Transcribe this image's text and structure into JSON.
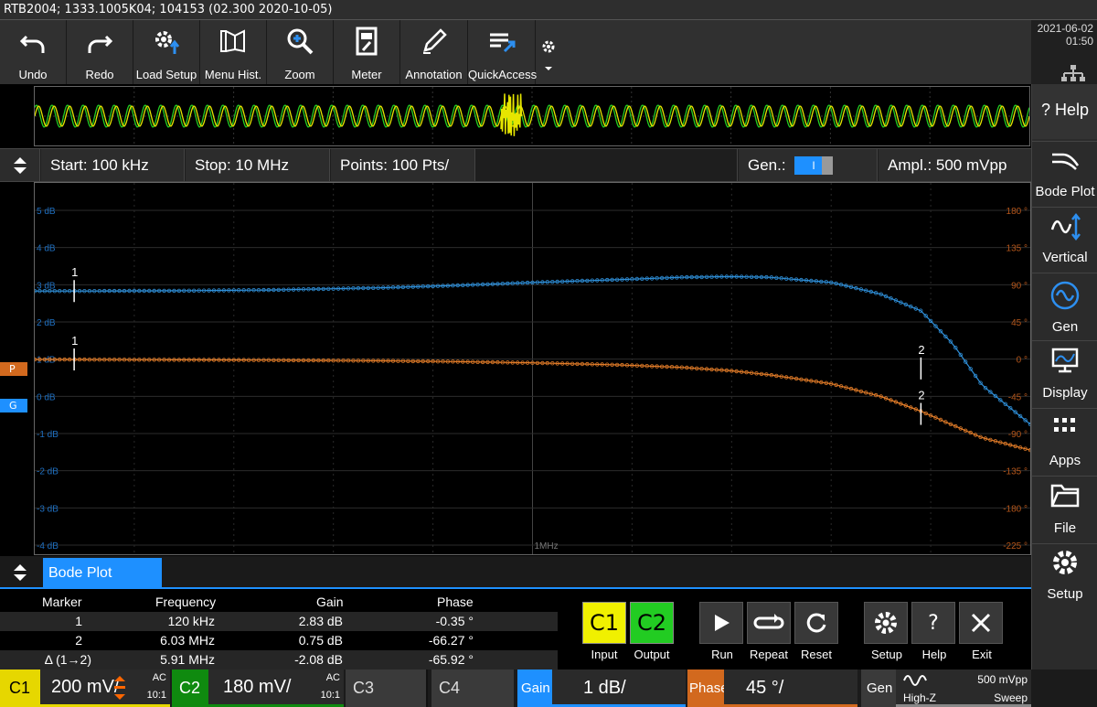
{
  "window": {
    "title": "RTB2004; 1333.1005K04; 104153 (02.300 2020-10-05)"
  },
  "datetime": {
    "date": "2021-06-02",
    "time": "01:50"
  },
  "toolbar": {
    "items": [
      {
        "label": "Undo",
        "icon": "undo-icon"
      },
      {
        "label": "Redo",
        "icon": "redo-icon"
      },
      {
        "label": "Load Setup",
        "icon": "load-setup-icon"
      },
      {
        "label": "Menu Hist.",
        "icon": "menu-history-icon"
      },
      {
        "label": "Zoom",
        "icon": "zoom-icon"
      },
      {
        "label": "Meter",
        "icon": "meter-icon"
      },
      {
        "label": "Annotation",
        "icon": "annotation-icon"
      },
      {
        "label": "QuickAccess",
        "icon": "quick-access-icon"
      }
    ]
  },
  "sidebar": {
    "items": [
      {
        "label": "Help",
        "icon": "help-icon"
      },
      {
        "label": "Bode Plot",
        "icon": "bode-plot-icon"
      },
      {
        "label": "Vertical",
        "icon": "vertical-icon"
      },
      {
        "label": "Gen",
        "icon": "generator-icon"
      },
      {
        "label": "Display",
        "icon": "display-icon"
      },
      {
        "label": "Apps",
        "icon": "apps-icon"
      },
      {
        "label": "File",
        "icon": "file-icon"
      },
      {
        "label": "Setup",
        "icon": "setup-icon"
      }
    ]
  },
  "params": {
    "start": "Start: 100 kHz",
    "stop": "Stop: 10 MHz",
    "points": "Points: 100 Pts/",
    "gen_label": "Gen.:",
    "gen_state": "I",
    "ampl": "Ampl.: 500 mVpp"
  },
  "plot": {
    "gain_labels": [
      "5 dB",
      "4 dB",
      "3 dB",
      "2 dB",
      "1 dB",
      "0 dB",
      "-1 dB",
      "-2 dB",
      "-3 dB",
      "-4 dB"
    ],
    "phase_labels": [
      "180 °",
      "135 °",
      "90 °",
      "45 °",
      "0 °",
      "-45 °",
      "-90 °",
      "-135 °",
      "-180 °",
      "-225 °"
    ],
    "x_label": "1MHz",
    "marker_p": "P",
    "marker_g": "G",
    "marker1": "1",
    "marker2": "2",
    "colors": {
      "gain": "#2f8fd8",
      "phase": "#e07b28"
    }
  },
  "bode": {
    "tab": "Bode Plot",
    "headers": [
      "Marker",
      "Frequency",
      "Gain",
      "Phase"
    ],
    "rows": [
      [
        "1",
        "120 kHz",
        "2.83 dB",
        "-0.35 °"
      ],
      [
        "2",
        "6.03 MHz",
        "0.75 dB",
        "-66.27 °"
      ],
      [
        "Δ (1→2)",
        "5.91 MHz",
        "-2.08 dB",
        "-65.92 °"
      ]
    ]
  },
  "controls": {
    "c1": "C1",
    "c2": "C2",
    "input": "Input",
    "output": "Output",
    "run": "Run",
    "repeat": "Repeat",
    "reset": "Reset",
    "setup": "Setup",
    "help": "Help",
    "exit": "Exit"
  },
  "channels": {
    "c1": {
      "name": "C1",
      "value": "200 mV/",
      "coupling": "AC",
      "probe": "10:1"
    },
    "c2": {
      "name": "C2",
      "value": "180 mV/",
      "coupling": "AC",
      "probe": "10:1"
    },
    "c3": {
      "name": "C3"
    },
    "c4": {
      "name": "C4"
    },
    "gain": {
      "name": "Gain",
      "value": "1 dB/"
    },
    "phase": {
      "name": "Phase",
      "value": "45 °/"
    },
    "gen": {
      "name": "Gen",
      "ampl": "500 mVpp",
      "imp": "High-Z",
      "mode": "Sweep"
    }
  },
  "chart_data": {
    "type": "line",
    "title": "",
    "xlabel": "",
    "x_scale": "log",
    "x": [
      100000,
      120000,
      200000,
      300000,
      500000,
      700000,
      1000000,
      1500000,
      2000000,
      2500000,
      3000000,
      4000000,
      5000000,
      6030000,
      7000000,
      8000000,
      10000000
    ],
    "ylim_gain": [
      -4,
      5
    ],
    "ylim_phase": [
      -225,
      180
    ],
    "series": [
      {
        "axis": "gain",
        "values": [
          2.83,
          2.83,
          2.84,
          2.86,
          2.92,
          2.98,
          3.06,
          3.14,
          3.2,
          3.22,
          3.2,
          3.06,
          2.75,
          2.3,
          1.4,
          0.3,
          -0.75
        ]
      },
      {
        "axis": "phase",
        "values": [
          -0.35,
          -0.5,
          -0.8,
          -1.2,
          -2.0,
          -3.0,
          -4.5,
          -7,
          -10,
          -14,
          -19,
          -30,
          -45,
          -63,
          -80,
          -95,
          -110
        ]
      }
    ],
    "markers": [
      {
        "name": "1",
        "frequency": "120 kHz",
        "gain": "2.83 dB",
        "phase": "-0.35 °"
      },
      {
        "name": "2",
        "frequency": "6.03 MHz",
        "gain": "0.75 dB",
        "phase": "-66.27 °"
      }
    ]
  }
}
